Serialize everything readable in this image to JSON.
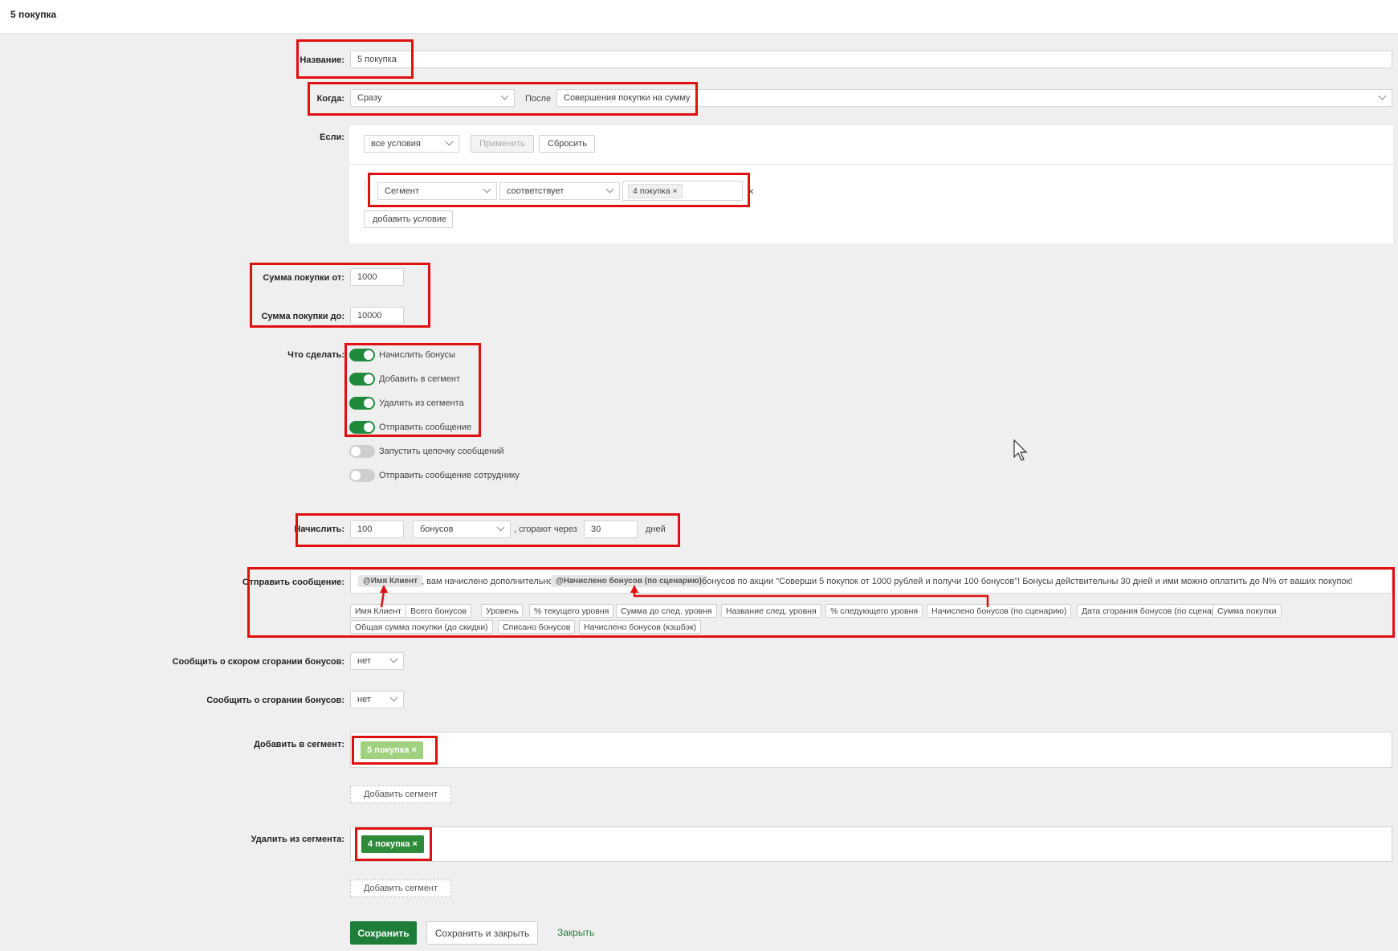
{
  "header": {
    "title": "5 покупка"
  },
  "name_field": {
    "label": "Название:",
    "value": "5 покупка"
  },
  "when": {
    "label": "Когда:",
    "value": "Сразу",
    "after_label": "После",
    "after_value": "Совершения покупки на сумму"
  },
  "conditions": {
    "label": "Если:",
    "mode": "все условия",
    "apply": "Применить",
    "reset": "Сбросить",
    "row": {
      "field": "Сегмент",
      "op": "соответствует",
      "value_tag": "4 покупка",
      "remove": "×"
    },
    "add": "добавить условие"
  },
  "sum": {
    "from_label": "Сумма покупки от:",
    "from_value": "1000",
    "to_label": "Сумма покупки до:",
    "to_value": "10000"
  },
  "actions": {
    "label": "Что сделать:",
    "items": [
      {
        "label": "Начислить бонусы",
        "on": true
      },
      {
        "label": "Добавить в сегмент",
        "on": true
      },
      {
        "label": "Удалить из сегмента",
        "on": true
      },
      {
        "label": "Отправить сообщение",
        "on": true
      },
      {
        "label": "Запустить цепочку сообщений",
        "on": false
      },
      {
        "label": "Отправить сообщение сотруднику",
        "on": false
      }
    ]
  },
  "accrue": {
    "label": "Начислить:",
    "amount": "100",
    "unit": "бонусов",
    "burn_text": ", сгорают через",
    "days": "30",
    "days_label": "дней"
  },
  "message": {
    "label": "Отправить сообщение:",
    "tag1": "@Имя Клиент",
    "text1": ", вам начислено дополнительно",
    "tag2": "@Начислено бонусов (по сценарию)",
    "text2": "бонусов по акции \"Соверши 5 покупок от 1000 рублей и получи 100 бонусов\"! Бонусы действительны 30 дней и ими можно оплатить до N% от ваших покупок!",
    "variables": [
      "Имя Клиент",
      "Всего бонусов",
      "Уровень",
      "% текущего уровня",
      "Сумма до след. уровня",
      "Название след. уровня",
      "% следующего уровня",
      "Начислено бонусов (по сценарию)",
      "Дата сгорания бонусов (по сценарию)",
      "Сумма покупки",
      "Общая сумма покупки (до скидки)",
      "Списано бонусов",
      "Начислено бонусов (кэшбэк)"
    ]
  },
  "notify_soon": {
    "label": "Сообщить о скором сгорании бонусов:",
    "value": "нет"
  },
  "notify_burn": {
    "label": "Сообщить о сгорании бонусов:",
    "value": "нет"
  },
  "add_segment": {
    "label": "Добавить в сегмент:",
    "tag": "5 покупка",
    "remove": "×",
    "add_button": "Добавить сегмент",
    "color": "#9fd17e"
  },
  "remove_segment": {
    "label": "Удалить из сегмента:",
    "tag": "4 покупка",
    "remove": "×",
    "add_button": "Добавить сегмент",
    "color": "#2e8b3a"
  },
  "footer": {
    "save": "Сохранить",
    "save_close": "Сохранить и закрыть",
    "close": "Закрыть"
  }
}
